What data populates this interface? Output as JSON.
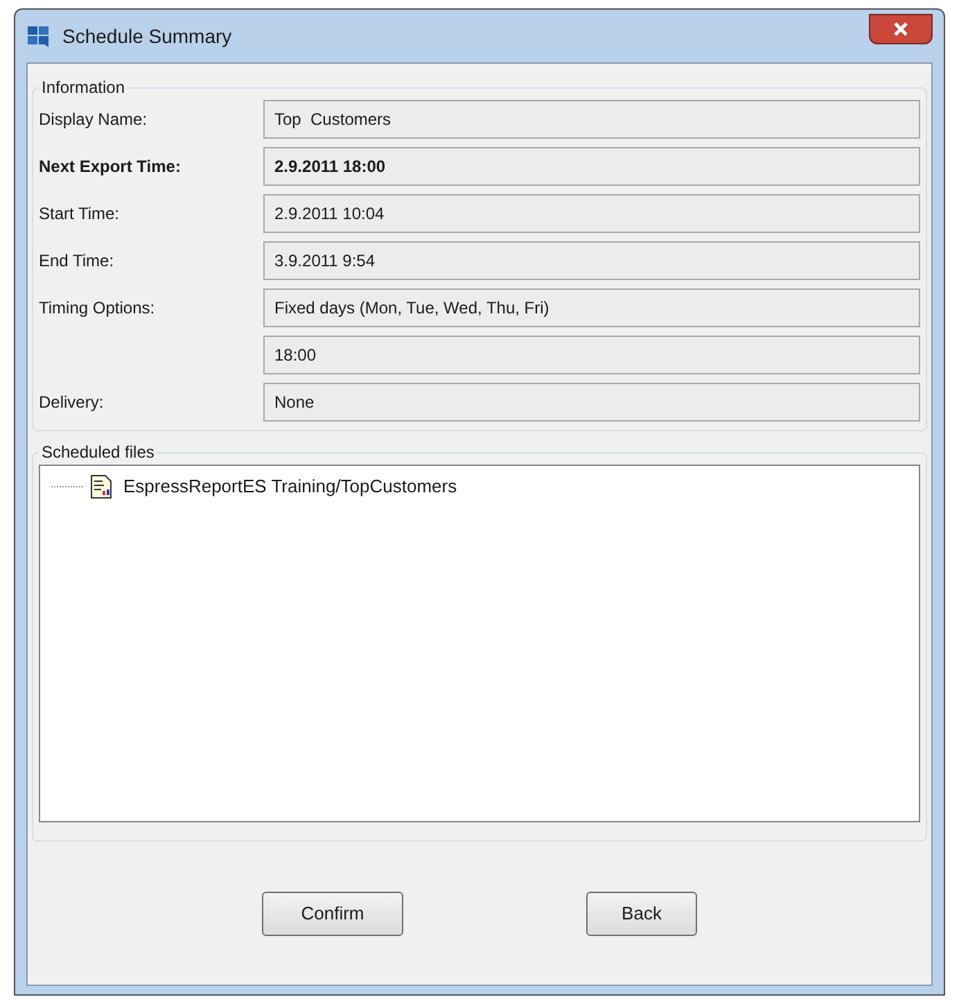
{
  "window": {
    "title": "Schedule Summary"
  },
  "information": {
    "legend": "Information",
    "rows": [
      {
        "label": "Display Name:",
        "value": "Top  Customers",
        "bold": false
      },
      {
        "label": "Next Export Time:",
        "value": "2.9.2011 18:00",
        "bold": true
      },
      {
        "label": "Start Time:",
        "value": "2.9.2011 10:04",
        "bold": false
      },
      {
        "label": "End Time:",
        "value": "3.9.2011 9:54",
        "bold": false
      },
      {
        "label": "Timing Options:",
        "value": "Fixed days (Mon, Tue, Wed, Thu, Fri)",
        "bold": false
      },
      {
        "value": "18:00",
        "bold": false
      },
      {
        "label": "Delivery:",
        "value": "None",
        "bold": false
      }
    ]
  },
  "scheduled_files": {
    "legend": "Scheduled files",
    "items": [
      {
        "label": "EspressReportES Training/TopCustomers"
      }
    ]
  },
  "buttons": [
    "Confirm",
    "Back"
  ]
}
